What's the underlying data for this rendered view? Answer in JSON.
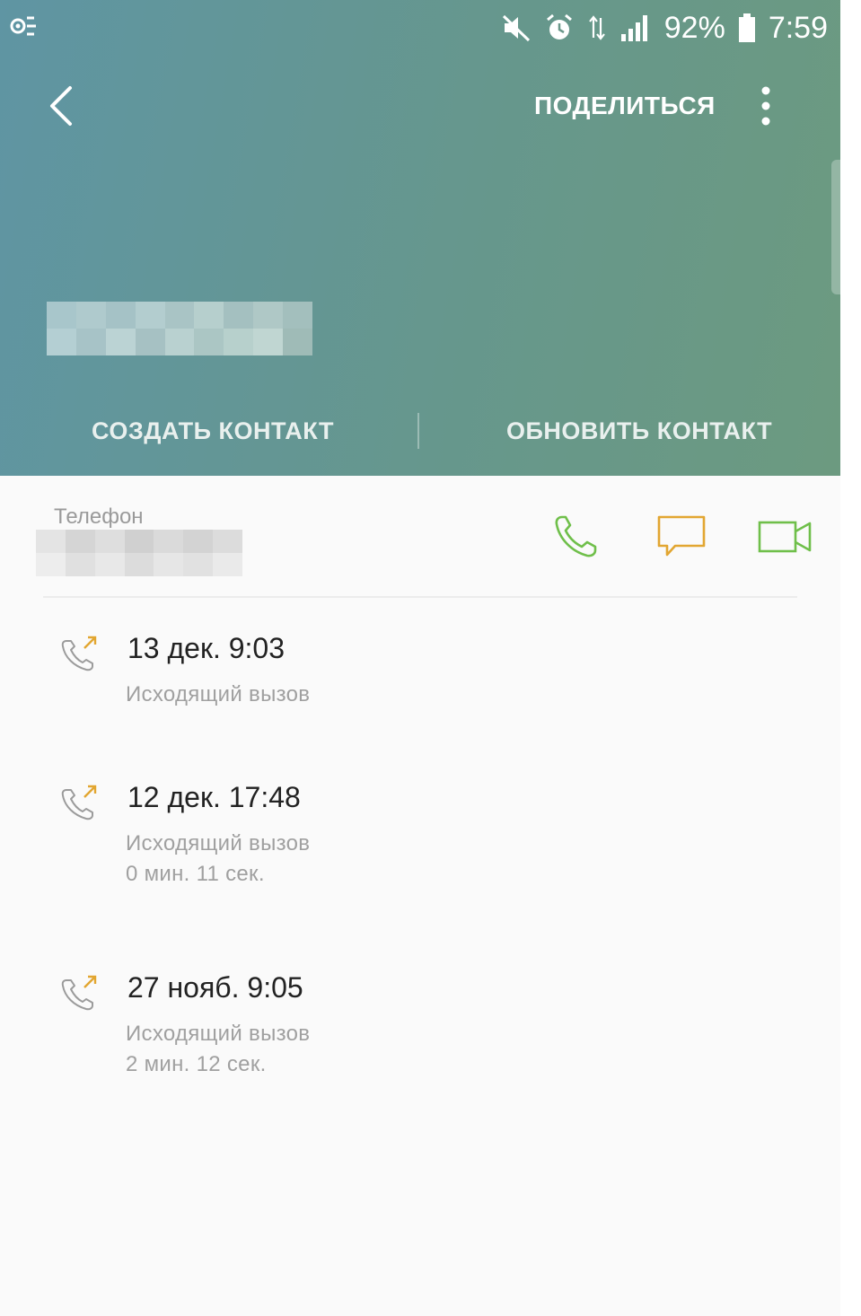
{
  "status_bar": {
    "battery": "92%",
    "time": "7:59",
    "icons": [
      "settings-cog-icon",
      "mute-icon",
      "alarm-icon",
      "data-arrows-icon",
      "signal-icon",
      "battery-icon"
    ]
  },
  "header": {
    "share_label": "ПОДЕЛИТЬСЯ",
    "icons": [
      "back-arrow-icon",
      "more-vertical-icon"
    ],
    "create_contact_label": "СОЗДАТЬ КОНТАКТ",
    "update_contact_label": "ОБНОВИТЬ КОНТАКТ",
    "gradient_colors": [
      "#5f95a3",
      "#66978d",
      "#6c9a80"
    ]
  },
  "phone": {
    "label": "Телефон",
    "icons": [
      "phone-call-icon",
      "message-icon",
      "video-call-icon"
    ],
    "colors": {
      "call": "#6fbf4a",
      "message": "#e2a631",
      "video": "#6fbf4a"
    }
  },
  "history": [
    {
      "datetime": "13 дек. 9:03",
      "type": "Исходящий вызов",
      "duration": ""
    },
    {
      "datetime": "12 дек. 17:48",
      "type": "Исходящий вызов",
      "duration": "0 мин. 11 сек."
    },
    {
      "datetime": "27 нояб. 9:05",
      "type": "Исходящий вызов",
      "duration": "2 мин. 12 сек."
    }
  ]
}
